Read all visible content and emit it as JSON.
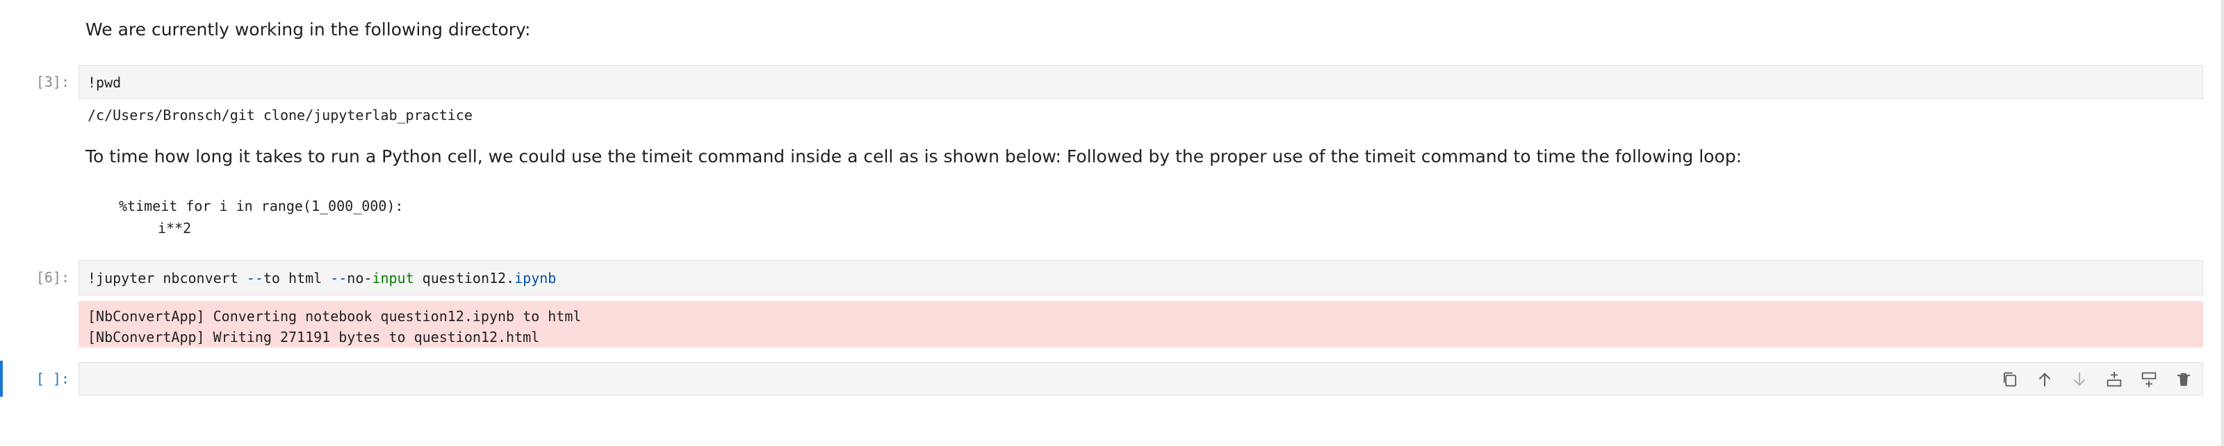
{
  "cells": {
    "md1": {
      "text": "We are currently working in the following directory:"
    },
    "cell3": {
      "prompt": "[3]:",
      "code": "!pwd",
      "output": "/c/Users/Bronsch/git clone/jupyterlab_practice"
    },
    "md2": {
      "text": "To time how long it takes to run a Python cell, we could use the timeit command inside a cell as is shown below: Followed by the proper use of the timeit command to time the following loop:",
      "code_line1": "%timeit for i in range(1_000_000):",
      "code_line2": "i**2"
    },
    "cell6": {
      "prompt": "[6]:",
      "code_part1": "!jupyter nbconvert ",
      "code_part2": "--",
      "code_part3": "to html ",
      "code_part4": "--",
      "code_part5": "no-",
      "code_part6": "input",
      "code_part7": " question12.",
      "code_part8": "ipynb",
      "stderr_line1": "[NbConvertApp] Converting notebook question12.ipynb to html",
      "stderr_line2": "[NbConvertApp] Writing 271191 bytes to question12.html"
    },
    "empty_cell": {
      "prompt": "[ ]:"
    }
  },
  "toolbar": {
    "icons": [
      "duplicate-icon",
      "move-up-icon",
      "move-down-icon",
      "insert-above-icon",
      "insert-below-icon",
      "delete-icon"
    ]
  },
  "colors": {
    "accent": "#1976d2",
    "stderr_bg": "#fddcdc",
    "code_bg": "#f5f5f5"
  }
}
